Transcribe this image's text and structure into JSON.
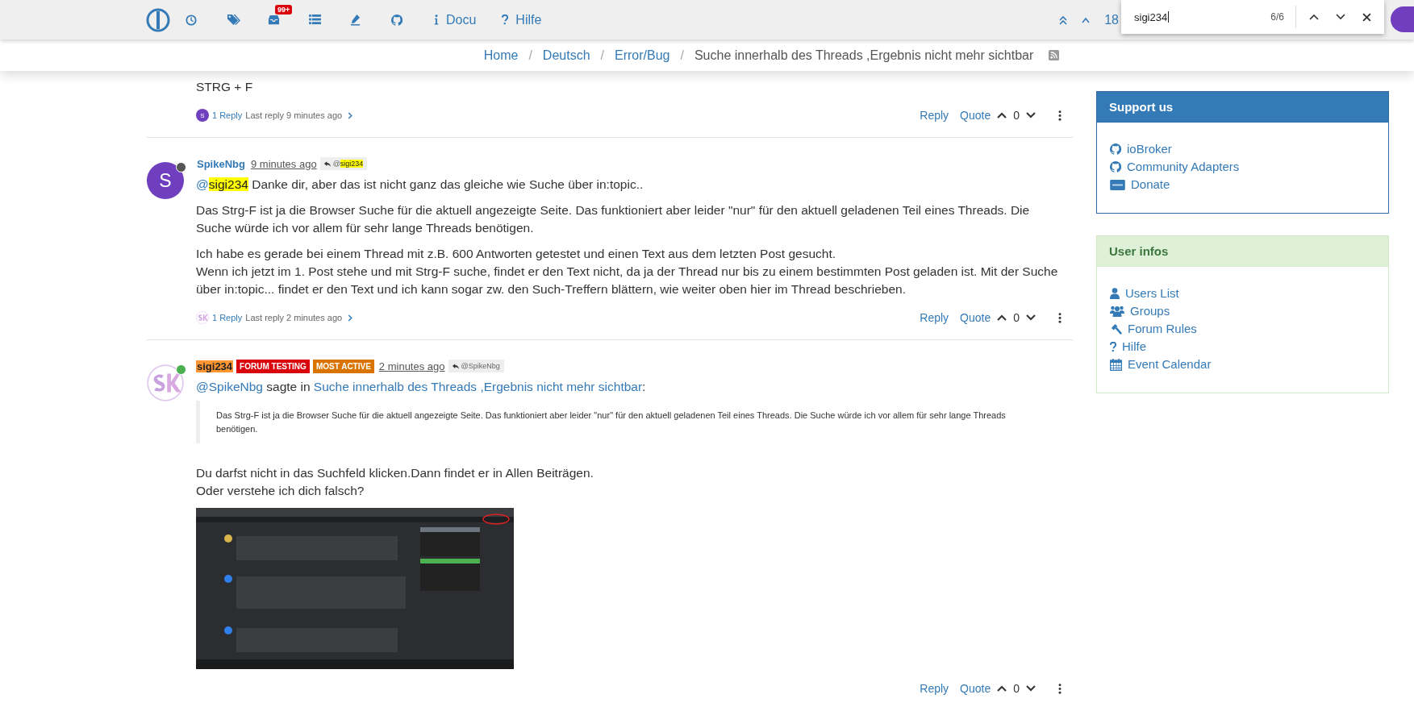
{
  "navbar": {
    "icons": [
      {
        "kind": "clock"
      },
      {
        "kind": "tags"
      },
      {
        "kind": "inbox",
        "badge": "99+"
      },
      {
        "kind": "list"
      },
      {
        "kind": "fire"
      },
      {
        "kind": "github"
      }
    ],
    "links": [
      {
        "label": "Docu"
      },
      {
        "label": "Hilfe"
      }
    ],
    "pagination": "18"
  },
  "find_bar": {
    "value": "sigi234",
    "count": "6/6"
  },
  "breadcrumb": [
    {
      "label": "Home",
      "link": true
    },
    {
      "separator": "/",
      "label": "Deutsch",
      "link": true
    },
    {
      "separator": "/",
      "label": "Error/Bug",
      "link": true
    },
    {
      "separator": "/",
      "label": "Suche innerhalb des Threads ,Ergebnis nicht mehr sichtbar",
      "link": false
    }
  ],
  "posts": [
    {
      "blocks": [
        {
          "kind": "paragraph",
          "lines": [
            "STRG + F"
          ]
        }
      ],
      "replies": {
        "avatar": {
          "kind": "letter",
          "letter": "S",
          "color": "#6f3fbf"
        },
        "count": "1 Reply",
        "last": "Last reply 9 minutes ago"
      },
      "actions": {
        "reply": "Reply",
        "quote": "Quote",
        "votes": "0"
      }
    },
    {
      "author": {
        "name": "SpikeNbg",
        "highlighted": false,
        "current_match": false,
        "avatar": {
          "kind": "letter",
          "letter": "S",
          "color": "#6f3fbf"
        },
        "online": false
      },
      "time": "9 minutes ago",
      "reply_to": {
        "prefix": "@",
        "name": "sigi234",
        "highlighted": true
      },
      "blocks": [
        {
          "kind": "mention",
          "prefix": "@",
          "name": "sigi234",
          "highlighted": true,
          "text": " Danke dir, aber das ist nicht ganz das gleiche wie Suche über in:topic.."
        },
        {
          "kind": "paragraph",
          "lines": [
            "Das Strg-F ist ja die Browser Suche für die aktuell angezeigte Seite. Das funktioniert aber leider \"nur\" für den aktuell geladenen Teil eines Threads. Die Suche würde ich vor allem für sehr lange Threads benötigen."
          ]
        },
        {
          "kind": "paragraph",
          "lines": [
            "Ich habe es gerade bei einem Thread mit z.B. 600 Antworten getestet und einen Text aus dem letzten Post gesucht.",
            "Wenn ich jetzt im 1. Post stehe und mit Strg-F suche, findet er den Text nicht, da ja der Thread nur bis zu einem bestimmten Post geladen ist. Mit der Suche über in:topic... findet er den Text und ich kann sogar zw. den Such-Treffern blättern, wie weiter oben hier im Thread beschrieben."
          ]
        }
      ],
      "replies": {
        "avatar": {
          "kind": "logo"
        },
        "count": "1 Reply",
        "last": "Last reply 2 minutes ago"
      },
      "actions": {
        "reply": "Reply",
        "quote": "Quote",
        "votes": "0"
      }
    },
    {
      "author": {
        "name": "sigi234",
        "highlighted": true,
        "current_match": true,
        "avatar": {
          "kind": "logo"
        },
        "online": true
      },
      "badges": [
        {
          "label": "FORUM TESTING",
          "color": "#d9040c"
        },
        {
          "label": "MOST ACTIVE",
          "color": "#d97400"
        }
      ],
      "time": "2 minutes ago",
      "reply_to": {
        "prefix": "@",
        "name": "SpikeNbg",
        "highlighted": false
      },
      "blocks": [
        {
          "kind": "quote_intro",
          "user": "@SpikeNbg",
          "middle": " sagte in ",
          "topic": "Suche innerhalb des Threads ,Ergebnis nicht mehr sichtbar",
          "end": ":"
        },
        {
          "kind": "blockquote",
          "text": "Das Strg-F ist ja die Browser Suche für die aktuell angezeigte Seite. Das funktioniert aber leider \"nur\" für den aktuell geladenen Teil eines Threads. Die Suche würde ich vor allem für sehr lange Threads benötigen."
        },
        {
          "kind": "paragraph",
          "lines": [
            "Du darfst nicht in das Suchfeld klicken.Dann findet er in Allen Beiträgen.",
            "Oder verstehe ich dich falsch?"
          ]
        },
        {
          "kind": "picture"
        }
      ],
      "actions": {
        "reply": "Reply",
        "quote": "Quote",
        "votes": "0"
      }
    }
  ],
  "sidebar": [
    {
      "title": "Support us",
      "items": [
        {
          "label": "ioBroker"
        },
        {
          "label": "Community Adapters"
        },
        {
          "label": "Donate"
        }
      ]
    },
    {
      "title": "User infos",
      "items": [
        {
          "label": "Users List"
        },
        {
          "label": "Groups"
        },
        {
          "label": "Forum Rules"
        },
        {
          "label": "Hilfe"
        },
        {
          "label": "Event Calendar"
        }
      ]
    }
  ]
}
